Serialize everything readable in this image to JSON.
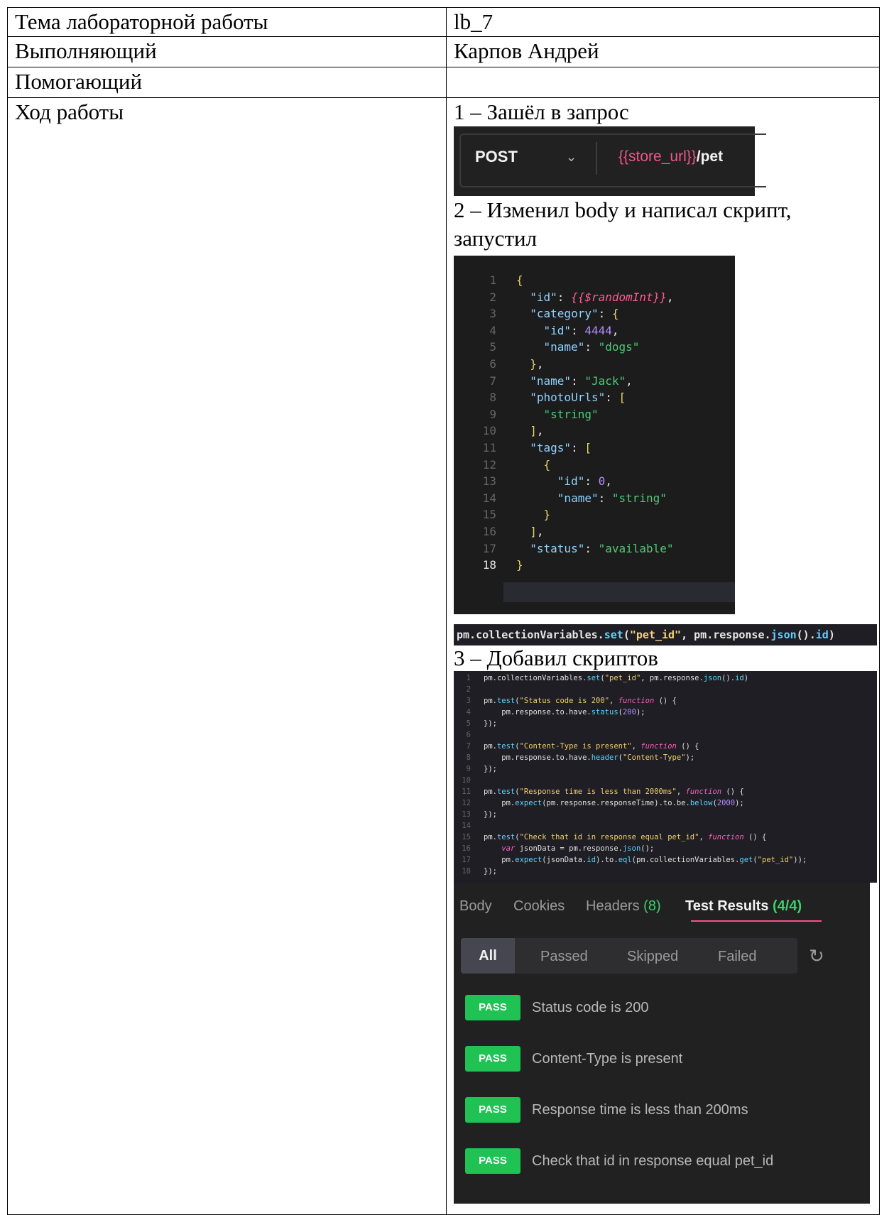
{
  "table": {
    "topic_label": "Тема лабораторной работы",
    "topic_value": "lb_7",
    "executor_label": "Выполняющий",
    "executor_value": "Карпов Андрей",
    "helper_label": "Помогающий",
    "helper_value": "",
    "progress_label": "Ход работы"
  },
  "steps": {
    "step1": "1 – Зашёл в запрос",
    "step2": "2 – Изменил body и написал скрипт, запустил",
    "step3": "3 – Добавил скриптов"
  },
  "request": {
    "method": "POST",
    "url_var": "{{store_url}}",
    "url_path": "/pet"
  },
  "json_body": {
    "line_numbers": [
      "1",
      "2",
      "3",
      "4",
      "5",
      "6",
      "7",
      "8",
      "9",
      "10",
      "11",
      "12",
      "13",
      "14",
      "15",
      "16",
      "17",
      "18"
    ],
    "id_key": "\"id\"",
    "id_value": "{{$randomInt}}",
    "category_key": "\"category\"",
    "category_id_value": "4444",
    "category_name_value": "\"dogs\"",
    "name_key": "\"name\"",
    "name_value": "\"Jack\"",
    "photo_key": "\"photoUrls\"",
    "photo_value": "\"string\"",
    "tags_key": "\"tags\"",
    "tag_id_value": "0",
    "tag_name_value": "\"string\"",
    "status_key": "\"status\"",
    "status_value": "\"available\""
  },
  "set_line": {
    "obj": "pm.collectionVariables.",
    "fn": "set",
    "arg1": "\"pet_id\"",
    "mid": ", pm.response.",
    "fn2": "json",
    "end": "().",
    "id": "id",
    "close": ")"
  },
  "test_results": {
    "tab_body": "Body",
    "tab_cookies": "Cookies",
    "tab_headers": "Headers",
    "tab_headers_count": "(8)",
    "tab_tests": "Test Results",
    "tab_tests_count": "(4/4)",
    "filter_all": "All",
    "filter_passed": "Passed",
    "filter_skipped": "Skipped",
    "filter_failed": "Failed",
    "badge": "PASS",
    "tests": [
      "Status code is 200",
      "Content-Type is present",
      "Response time is less than 200ms",
      "Check that id in response equal pet_id"
    ]
  },
  "colors": {
    "editor_bg": "#1c1c1c",
    "pass_green": "#1fc253",
    "accent_pink": "#f0568a"
  }
}
